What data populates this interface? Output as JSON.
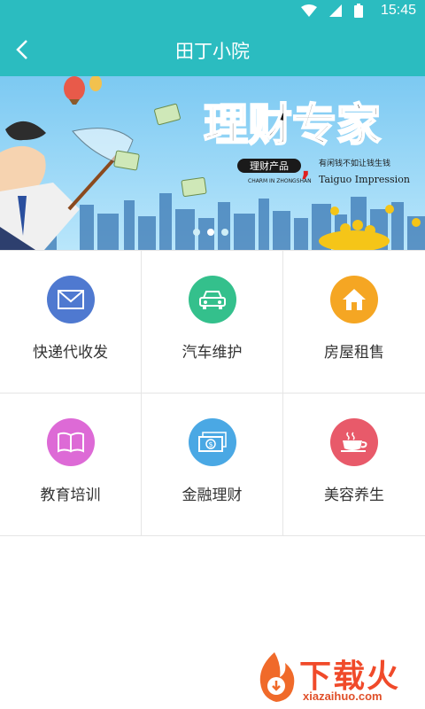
{
  "status_bar": {
    "time": "15:45"
  },
  "header": {
    "title": "田丁小院"
  },
  "banner": {
    "headline": "理财专家",
    "tag": "理财产品",
    "slogan": "有闲钱不如让钱生钱",
    "en_small": "CHARM IN ZHONGSHAN",
    "brand": "Taiguo Impression",
    "dot_count": 3,
    "active_dot": 1
  },
  "services": [
    {
      "label": "快递代收发",
      "icon": "envelope-icon",
      "color": "#4f79d0"
    },
    {
      "label": "汽车维护",
      "icon": "car-icon",
      "color": "#34c08c"
    },
    {
      "label": "房屋租售",
      "icon": "house-icon",
      "color": "#f5a623"
    },
    {
      "label": "教育培训",
      "icon": "book-icon",
      "color": "#dd6ad6"
    },
    {
      "label": "金融理财",
      "icon": "money-icon",
      "color": "#4aa8e4"
    },
    {
      "label": "美容养生",
      "icon": "coffee-cup-icon",
      "color": "#e85a6a"
    }
  ],
  "watermark": {
    "text": "下载火",
    "sub": "xiazaihuo.com"
  }
}
